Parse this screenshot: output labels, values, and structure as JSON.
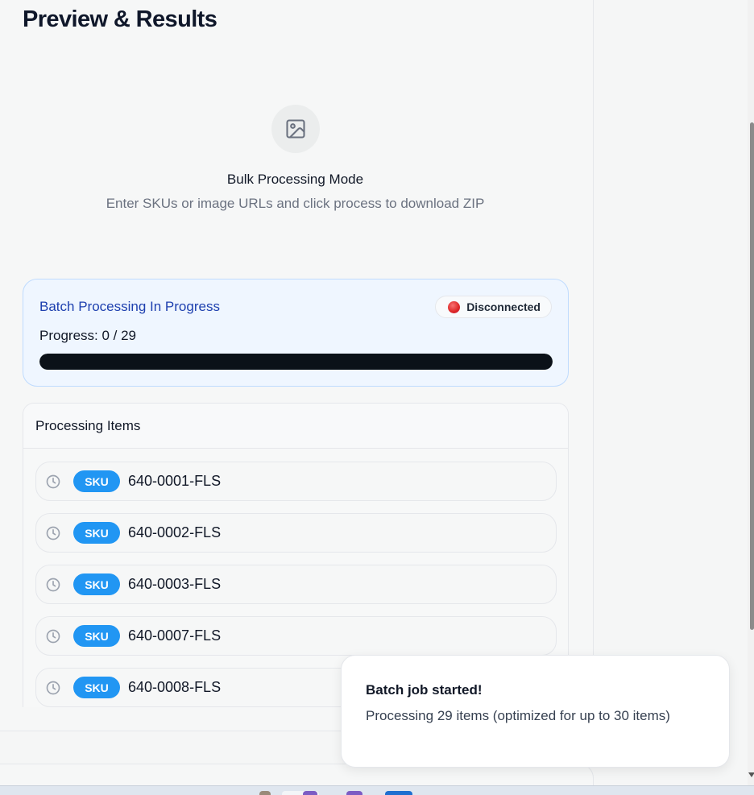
{
  "panel": {
    "title": "Preview & Results"
  },
  "empty_state": {
    "icon": "image-icon",
    "heading": "Bulk Processing Mode",
    "subtext": "Enter SKUs or image URLs and click process to download ZIP"
  },
  "batch": {
    "title": "Batch Processing In Progress",
    "status": "Disconnected",
    "status_color": "#dc2626",
    "progress_label": "Progress: 0 / 29",
    "progress_completed": 0,
    "progress_total": 29
  },
  "items": {
    "header": "Processing Items",
    "badge": "SKU",
    "list": [
      {
        "sku": "640-0001-FLS",
        "status_icon": "clock-icon"
      },
      {
        "sku": "640-0002-FLS",
        "status_icon": "clock-icon"
      },
      {
        "sku": "640-0003-FLS",
        "status_icon": "clock-icon"
      },
      {
        "sku": "640-0007-FLS",
        "status_icon": "clock-icon"
      },
      {
        "sku": "640-0008-FLS",
        "status_icon": "clock-icon"
      }
    ]
  },
  "toast": {
    "title": "Batch job started!",
    "message": "Processing 29 items (optimized for up to 30 items)"
  },
  "colors": {
    "accent": "#2196f3",
    "batch_title": "#1e40af",
    "progress_fill": "#0b1118"
  }
}
